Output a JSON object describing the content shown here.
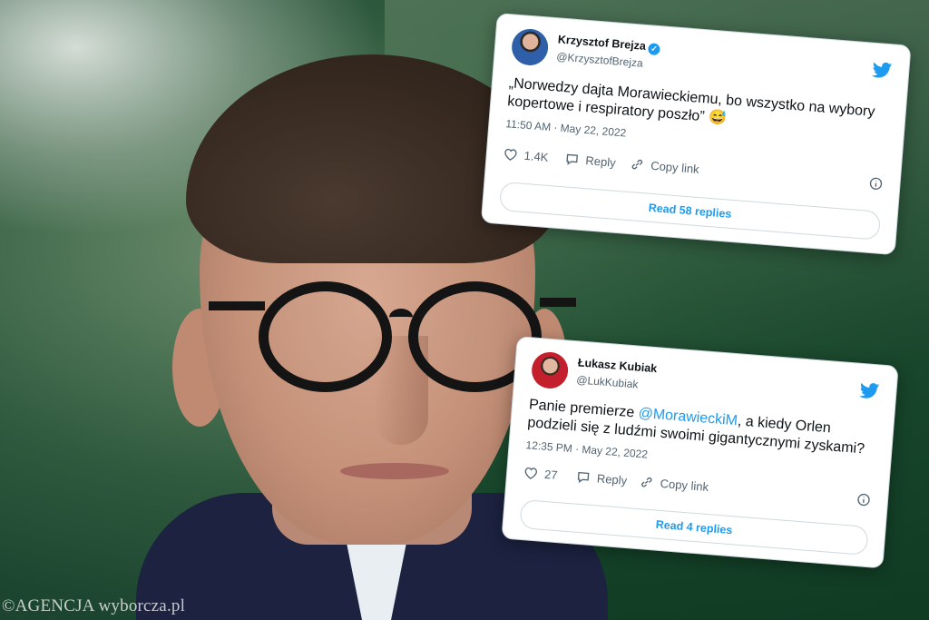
{
  "watermark": "©AGENCJA wyborcza.pl",
  "tweets": [
    {
      "name": "Krzysztof Brejza",
      "handle": "@KrzysztofBrejza",
      "text_before": "„Norwedzy dajta Morawieckiemu, bo wszystko na wybory kopertowe i respiratory poszło” 😅",
      "mention": "",
      "text_after": "",
      "time": "11:50 AM · May 22, 2022",
      "likes": "1.4K",
      "reply_label": "Reply",
      "copy_label": "Copy link",
      "read_replies": "Read 58 replies",
      "verified": true
    },
    {
      "name": "Łukasz Kubiak",
      "handle": "@LukKubiak",
      "text_before": "Panie premierze ",
      "mention": "@MorawieckiM",
      "text_after": ", a kiedy Orlen podzieli się z ludźmi swoimi gigantycznymi zyskami?",
      "time": "12:35 PM · May 22, 2022",
      "likes": "27",
      "reply_label": "Reply",
      "copy_label": "Copy link",
      "read_replies": "Read 4 replies",
      "verified": false
    }
  ],
  "colors": {
    "twitter_blue": "#1d9bf0",
    "text": "#0f1419",
    "muted": "#536471"
  },
  "icons": [
    "twitter-bird-icon",
    "heart-icon",
    "reply-icon",
    "link-icon",
    "info-icon",
    "verified-badge-icon"
  ]
}
